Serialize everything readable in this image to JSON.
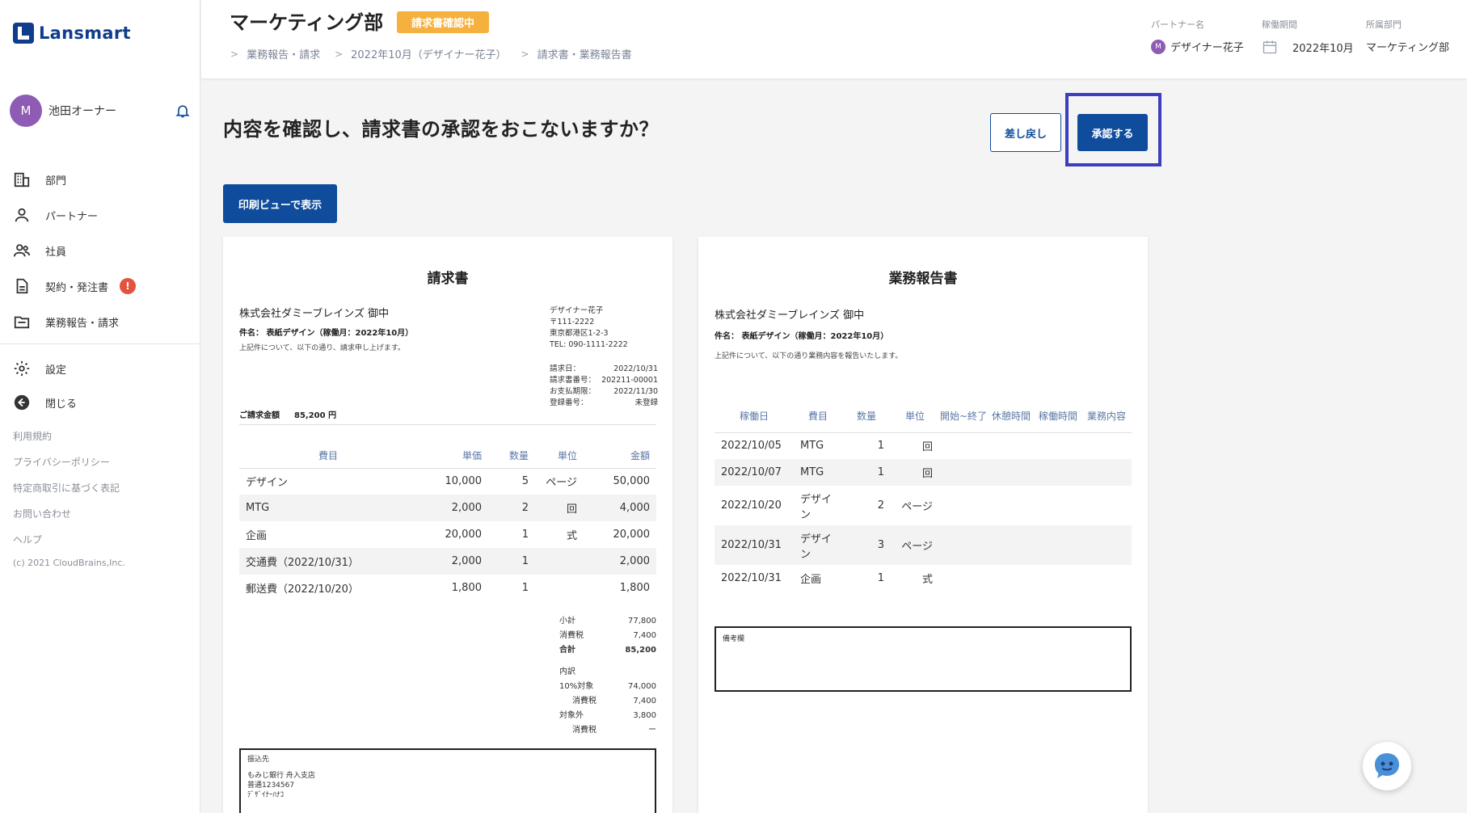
{
  "brand": {
    "name": "Lansmart"
  },
  "user": {
    "initial": "M",
    "name": "池田オーナー"
  },
  "nav": {
    "items": [
      {
        "label": "部門",
        "icon": "building-icon"
      },
      {
        "label": "パートナー",
        "icon": "person-icon"
      },
      {
        "label": "社員",
        "icon": "people-icon"
      },
      {
        "label": "契約・発注書",
        "icon": "document-icon",
        "badge": "!"
      },
      {
        "label": "業務報告・請求",
        "icon": "folder-icon"
      }
    ],
    "settings": "設定",
    "close": "閉じる"
  },
  "footer_links": [
    "利用規約",
    "プライバシーポリシー",
    "特定商取引に基づく表記",
    "お問い合わせ",
    "ヘルプ"
  ],
  "copyright": "(c) 2021 CloudBrains,Inc.",
  "header": {
    "title": "マーケティング部",
    "status": "請求書確認中",
    "breadcrumb": [
      "業務報告・請求",
      "2022年10月（デザイナー花子）",
      "請求書・業務報告書"
    ],
    "partner_label": "パートナー名",
    "partner_initial": "M",
    "partner_value": "デザイナー花子",
    "period_label": "稼働期間",
    "period_value": "2022年10月",
    "dept_label": "所属部門",
    "dept_value": "マーケティング部"
  },
  "main": {
    "question": "内容を確認し、請求書の承認をおこないますか？",
    "return_button": "差し戻し",
    "approve_button": "承認する",
    "print_button": "印刷ビューで表示"
  },
  "invoice": {
    "title": "請求書",
    "to": "株式会社ダミーブレインズ 御中",
    "subject": "件名： 表紙デザイン（稼働月：2022年10月）",
    "description": "上記件について、以下の通り、請求申し上げます。",
    "issuer": [
      "デザイナー花子",
      "〒111-2222",
      "東京都港区1-2-3",
      "TEL: 090-1111-2222"
    ],
    "info": [
      {
        "label": "請求日：",
        "value": "2022/10/31"
      },
      {
        "label": "請求書番号：",
        "value": "202211-00001"
      },
      {
        "label": "お支払期限：",
        "value": "2022/11/30"
      },
      {
        "label": "登録番号：",
        "value": "未登録"
      }
    ],
    "amount_label": "ご請求金額",
    "amount_value": "85,200 円",
    "headers": [
      "費目",
      "単価",
      "数量",
      "単位",
      "金額"
    ],
    "rows": [
      {
        "item": "デザイン",
        "price": "10,000",
        "qty": "5",
        "unit": "ページ",
        "amount": "50,000"
      },
      {
        "item": "MTG",
        "price": "2,000",
        "qty": "2",
        "unit": "回",
        "amount": "4,000"
      },
      {
        "item": "企画",
        "price": "20,000",
        "qty": "1",
        "unit": "式",
        "amount": "20,000"
      },
      {
        "item": "交通費（2022/10/31）",
        "price": "2,000",
        "qty": "1",
        "unit": "",
        "amount": "2,000"
      },
      {
        "item": "郵送費（2022/10/20）",
        "price": "1,800",
        "qty": "1",
        "unit": "",
        "amount": "1,800"
      }
    ],
    "totals": [
      {
        "label": "小計",
        "value": "77,800",
        "bold": false
      },
      {
        "label": "消費税",
        "value": "7,400",
        "bold": false
      },
      {
        "label": "合計",
        "value": "85,200",
        "bold": true
      }
    ],
    "breakdown_label": "内訳",
    "breakdown": [
      {
        "label": "10%対象",
        "value": "74,000",
        "indent": false
      },
      {
        "label": "消費税",
        "value": "7,400",
        "indent": true
      },
      {
        "label": "対象外",
        "value": "3,800",
        "indent": false
      },
      {
        "label": "消費税",
        "value": "ー",
        "indent": true
      }
    ],
    "bank_label": "振込先",
    "bank_lines": [
      "もみじ銀行 舟入支店",
      "普通1234567",
      "ﾃﾞｻﾞｲﾅｰﾊﾅｺ"
    ]
  },
  "report": {
    "title": "業務報告書",
    "to": "株式会社ダミーブレインズ 御中",
    "subject": "件名： 表紙デザイン（稼働月：2022年10月）",
    "description": "上記件について、以下の通り業務内容を報告いたします。",
    "headers": [
      "稼働日",
      "費目",
      "数量",
      "単位",
      "開始~終了",
      "休憩時間",
      "稼働時間",
      "業務内容"
    ],
    "rows": [
      {
        "date": "2022/10/05",
        "item": "MTG",
        "qty": "1",
        "unit": "回"
      },
      {
        "date": "2022/10/07",
        "item": "MTG",
        "qty": "1",
        "unit": "回"
      },
      {
        "date": "2022/10/20",
        "item": "デザイン",
        "qty": "2",
        "unit": "ページ"
      },
      {
        "date": "2022/10/31",
        "item": "デザイン",
        "qty": "3",
        "unit": "ページ"
      },
      {
        "date": "2022/10/31",
        "item": "企画",
        "qty": "1",
        "unit": "式"
      }
    ],
    "notes_label": "備考欄"
  }
}
